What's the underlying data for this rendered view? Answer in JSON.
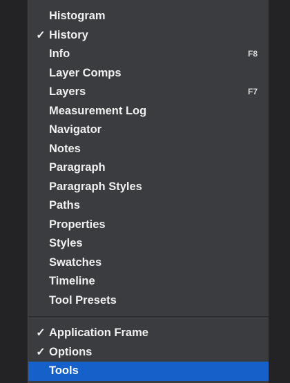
{
  "menu": {
    "top_items": [
      {
        "label": "Histogram",
        "checked": false,
        "shortcut": ""
      },
      {
        "label": "History",
        "checked": true,
        "shortcut": ""
      },
      {
        "label": "Info",
        "checked": false,
        "shortcut": "F8"
      },
      {
        "label": "Layer Comps",
        "checked": false,
        "shortcut": ""
      },
      {
        "label": "Layers",
        "checked": false,
        "shortcut": "F7"
      },
      {
        "label": "Measurement Log",
        "checked": false,
        "shortcut": ""
      },
      {
        "label": "Navigator",
        "checked": false,
        "shortcut": ""
      },
      {
        "label": "Notes",
        "checked": false,
        "shortcut": ""
      },
      {
        "label": "Paragraph",
        "checked": false,
        "shortcut": ""
      },
      {
        "label": "Paragraph Styles",
        "checked": false,
        "shortcut": ""
      },
      {
        "label": "Paths",
        "checked": false,
        "shortcut": ""
      },
      {
        "label": "Properties",
        "checked": false,
        "shortcut": ""
      },
      {
        "label": "Styles",
        "checked": false,
        "shortcut": ""
      },
      {
        "label": "Swatches",
        "checked": false,
        "shortcut": ""
      },
      {
        "label": "Timeline",
        "checked": false,
        "shortcut": ""
      },
      {
        "label": "Tool Presets",
        "checked": false,
        "shortcut": ""
      }
    ],
    "bottom_items": [
      {
        "label": "Application Frame",
        "checked": true,
        "selected": false
      },
      {
        "label": "Options",
        "checked": true,
        "selected": false
      },
      {
        "label": "Tools",
        "checked": false,
        "selected": true
      }
    ],
    "check_glyph": "✓",
    "colors": {
      "menu_bg": "#3b3c3f",
      "highlight": "#1560c9",
      "text": "#f0f0f0"
    }
  }
}
